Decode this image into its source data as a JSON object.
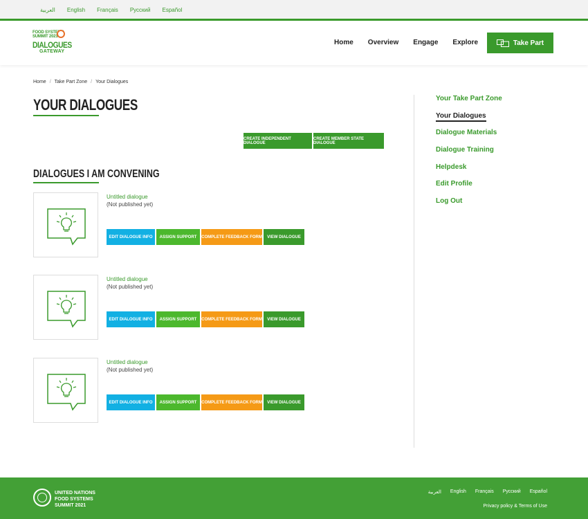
{
  "languages": [
    "العربية",
    "English",
    "Français",
    "Русский",
    "Español"
  ],
  "logo": {
    "line1": "FOOD SYSTEMS",
    "line1b": "SUMMIT 2021",
    "line2": "DIALOGUES",
    "line3": "GATEWAY"
  },
  "nav": {
    "home": "Home",
    "overview": "Overview",
    "engage": "Engage",
    "explore": "Explore",
    "take_part": "Take Part"
  },
  "breadcrumb": {
    "home": "Home",
    "zone": "Take Part Zone",
    "current": "Your Dialogues",
    "sep": "/"
  },
  "page": {
    "title": "YOUR DIALOGUES",
    "create_independent": "CREATE INDEPENDENT DIALOGUE",
    "create_member_state": "CREATE MEMBER STATE DIALOGUE",
    "section_title": "DIALOGUES I AM CONVENING"
  },
  "dialogues": [
    {
      "title": "Untitled dialogue",
      "status": "(Not published yet)"
    },
    {
      "title": "Untitled dialogue",
      "status": "(Not published yet)"
    },
    {
      "title": "Untitled dialogue",
      "status": "(Not published yet)"
    }
  ],
  "dialogue_actions": {
    "edit": "EDIT DIALOGUE INFO",
    "assign": "ASSIGN SUPPORT",
    "feedback": "COMPLETE FEEDBACK FORM",
    "view": "VIEW DIALOGUE"
  },
  "sidebar": {
    "items": [
      {
        "label": "Your Take Part Zone"
      },
      {
        "label": "Your Dialogues"
      },
      {
        "label": "Dialogue Materials"
      },
      {
        "label": "Dialogue Training"
      },
      {
        "label": "Helpdesk"
      },
      {
        "label": "Edit Profile"
      },
      {
        "label": "Log Out"
      }
    ]
  },
  "footer": {
    "logo_line1": "UNITED NATIONS",
    "logo_line2": "FOOD SYSTEMS",
    "logo_line3": "SUMMIT 2021",
    "languages": [
      "العربية",
      "English",
      "Français",
      "Русский",
      "Español"
    ],
    "privacy": "Privacy policy",
    "amp": "&",
    "terms": "Terms of Use"
  },
  "colors": {
    "accent": "#3a9a2c",
    "cyan": "#12b0e3",
    "orange": "#f59a16",
    "light_green": "#4cb82d"
  },
  "icons": [
    "lightbulb-speech-icon",
    "chat-bubbles-icon",
    "un-emblem-icon"
  ]
}
